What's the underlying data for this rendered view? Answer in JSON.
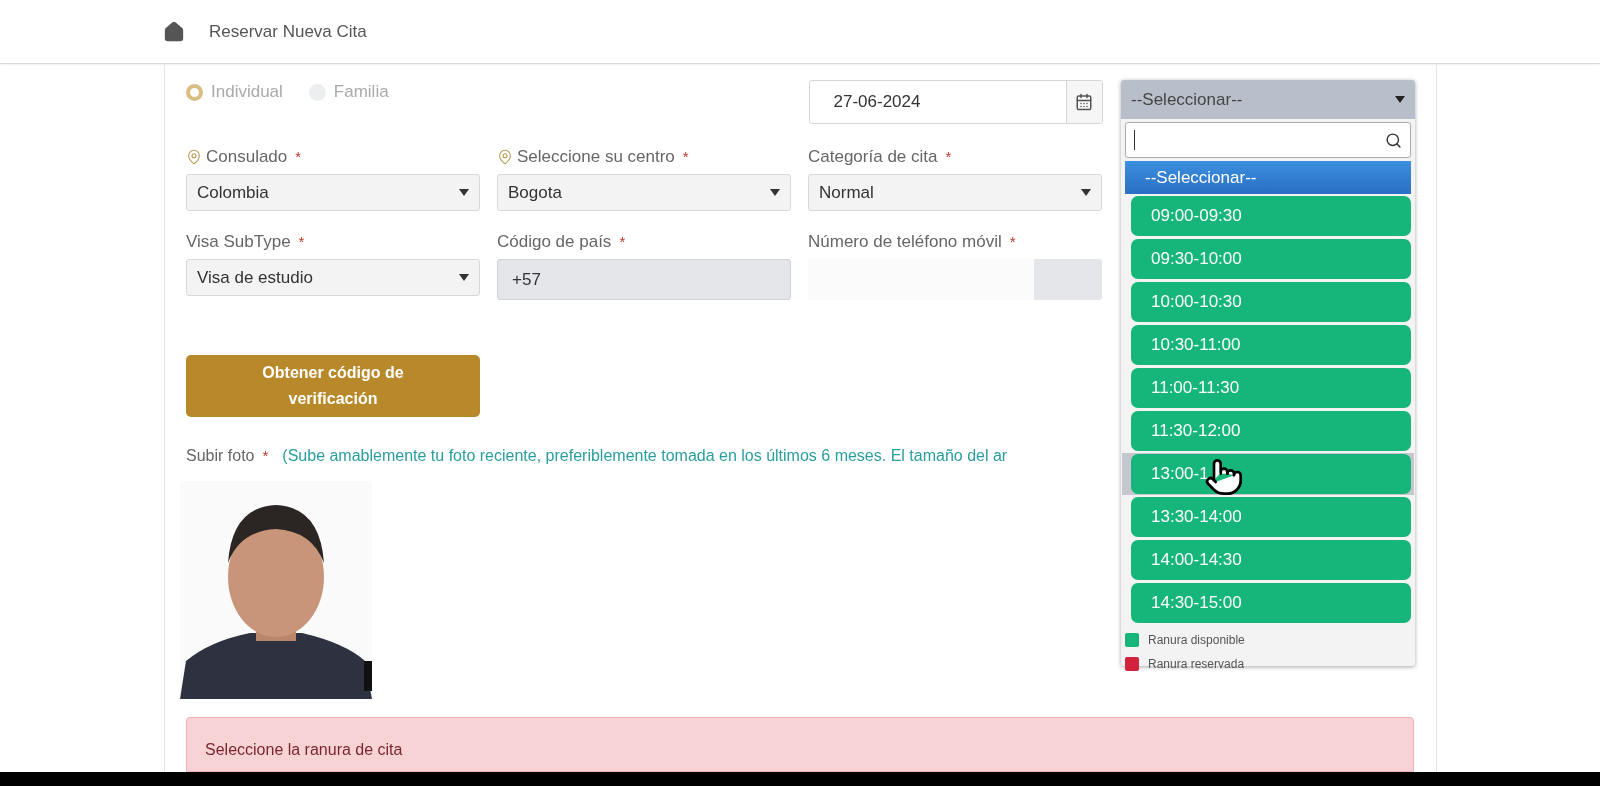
{
  "header": {
    "title": "Reservar Nueva Cita"
  },
  "applicant_type": [
    {
      "label": "Individual",
      "selected": true
    },
    {
      "label": "Familia",
      "selected": false
    }
  ],
  "date_field": {
    "value": "27-06-2024"
  },
  "fields": [
    {
      "label": "Consulado",
      "required": true,
      "kind": "location-select",
      "value": "Colombia"
    },
    {
      "label": "Seleccione su centro",
      "required": true,
      "kind": "location-select",
      "value": "Bogota"
    },
    {
      "label": "Categoría de cita",
      "required": true,
      "kind": "select",
      "value": "Normal"
    },
    {
      "label": "Visa SubType",
      "required": true,
      "kind": "select",
      "value": "Visa de estudio"
    },
    {
      "label": "Código de país",
      "required": true,
      "kind": "readonly",
      "value": "+57"
    },
    {
      "label": "Número de teléfono móvil",
      "required": true,
      "kind": "masked"
    }
  ],
  "verify_button": {
    "label": "Obtener código de verificación"
  },
  "photo": {
    "label": "Subir foto",
    "required": true,
    "hint": "(Sube amablemente tu foto reciente, preferiblemente tomada en los últimos 6 meses. El tamaño del ar",
    "kind": "picture"
  },
  "slot_dropdown": {
    "value": "--Seleccionar--",
    "options": [
      {
        "label": "--Seleccionar--",
        "kind": "placeholder",
        "selected": true
      },
      {
        "label": "09:00-09:30",
        "kind": "slot",
        "selected": false,
        "hovered": false
      },
      {
        "label": "09:30-10:00",
        "kind": "slot",
        "selected": false,
        "hovered": false
      },
      {
        "label": "10:00-10:30",
        "kind": "slot",
        "selected": false,
        "hovered": false
      },
      {
        "label": "10:30-11:00",
        "kind": "slot",
        "selected": false,
        "hovered": false
      },
      {
        "label": "11:00-11:30",
        "kind": "slot",
        "selected": false,
        "hovered": false
      },
      {
        "label": "11:30-12:00",
        "kind": "slot",
        "selected": false,
        "hovered": false
      },
      {
        "label": "13:00-1",
        "kind": "slot",
        "selected": false,
        "hovered": true
      },
      {
        "label": "13:30-14:00",
        "kind": "slot",
        "selected": false,
        "hovered": false
      },
      {
        "label": "14:00-14:30",
        "kind": "slot",
        "selected": false,
        "hovered": false
      },
      {
        "label": "14:30-15:00",
        "kind": "slot",
        "selected": false,
        "hovered": false
      }
    ],
    "legend": [
      {
        "label": "Ranura disponible",
        "color": "#16b67a"
      },
      {
        "label": "Ranura reservada",
        "color": "#d32240"
      }
    ]
  },
  "alert": {
    "message": "Seleccione la ranura de cita"
  },
  "required_mark": "*"
}
